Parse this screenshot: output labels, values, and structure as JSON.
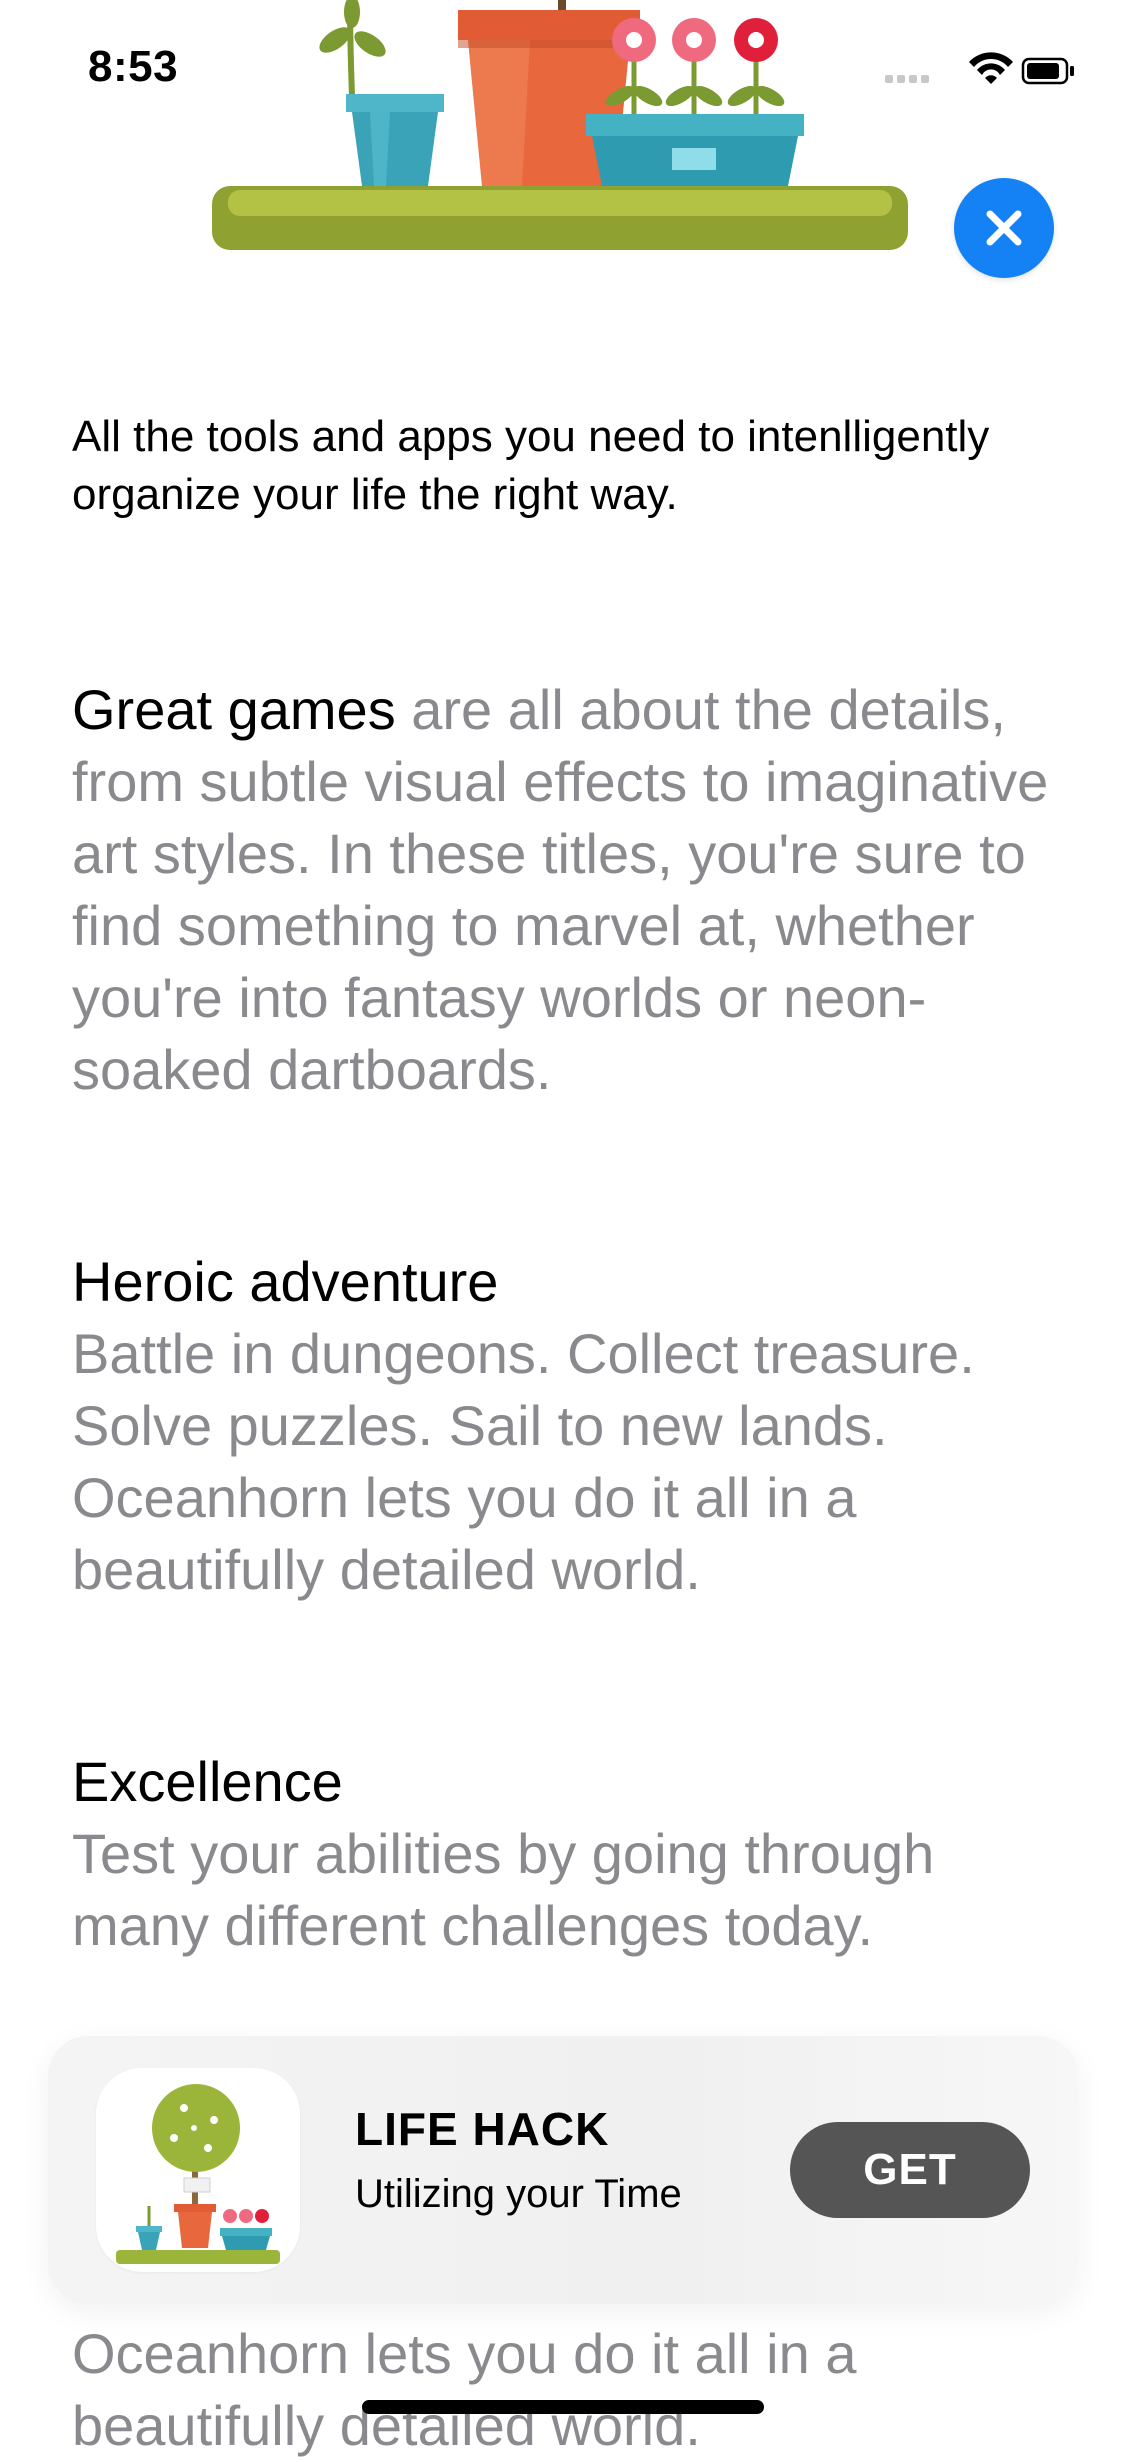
{
  "status_bar": {
    "time": "8:53"
  },
  "intro": "All the tools and apps you need to intenlligently organize your life the right way.",
  "sections": [
    {
      "lead": "Great games",
      "body": " are all about the details, from subtle visual effects to imaginative art styles. In these titles, you're sure to find something to marvel at, whether you're into fantasy worlds or neon-soaked dartboards."
    },
    {
      "lead": "Heroic adventure",
      "body": "Battle in dungeons. Collect treasure. Solve puzzles. Sail to new lands. Oceanhorn lets you do it all in a beautifully detailed world."
    },
    {
      "lead": "Excellence",
      "body": "Test your abilities by going through many different challenges today."
    }
  ],
  "banner": {
    "app_name": "LIFE HACK",
    "subtitle": "Utilizing your Time",
    "get_label": "GET"
  },
  "bottom_text": "Oceanhorn lets you do it all in a beautifully detailed world.",
  "icons": {
    "close": "close-icon",
    "wifi": "wifi-icon",
    "battery": "battery-icon",
    "signal": "signal-icon"
  },
  "colors": {
    "accent_blue": "#1482f5",
    "get_button": "#555555",
    "body_gray": "#8a8a8e"
  }
}
